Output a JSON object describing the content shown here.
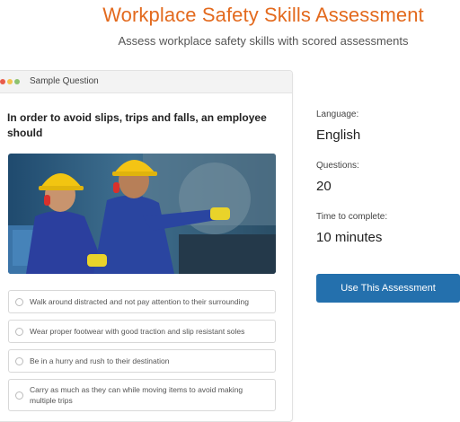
{
  "header": {
    "title": "Workplace Safety Skills Assessment",
    "subtitle": "Assess workplace safety skills with scored assessments"
  },
  "sample_card": {
    "header_label": "Sample Question",
    "question": "In order to avoid slips, trips and falls, an employee should",
    "options": [
      "Walk around distracted and not pay attention to their surrounding",
      "Wear proper footwear with good traction and slip resistant soles",
      "Be in a hurry and rush to their destination",
      "Carry as much as they can while moving items to avoid making multiple trips"
    ]
  },
  "details": {
    "language_label": "Language:",
    "language_value": "English",
    "questions_label": "Questions:",
    "questions_value": "20",
    "time_label": "Time to complete:",
    "time_value": "10 minutes"
  },
  "cta": {
    "label": "Use This Assessment"
  },
  "colors": {
    "title": "#e36a1e",
    "button": "#2470ad"
  },
  "icons": {
    "window_dots": "window-controls-icon",
    "radio": "radio-icon"
  }
}
